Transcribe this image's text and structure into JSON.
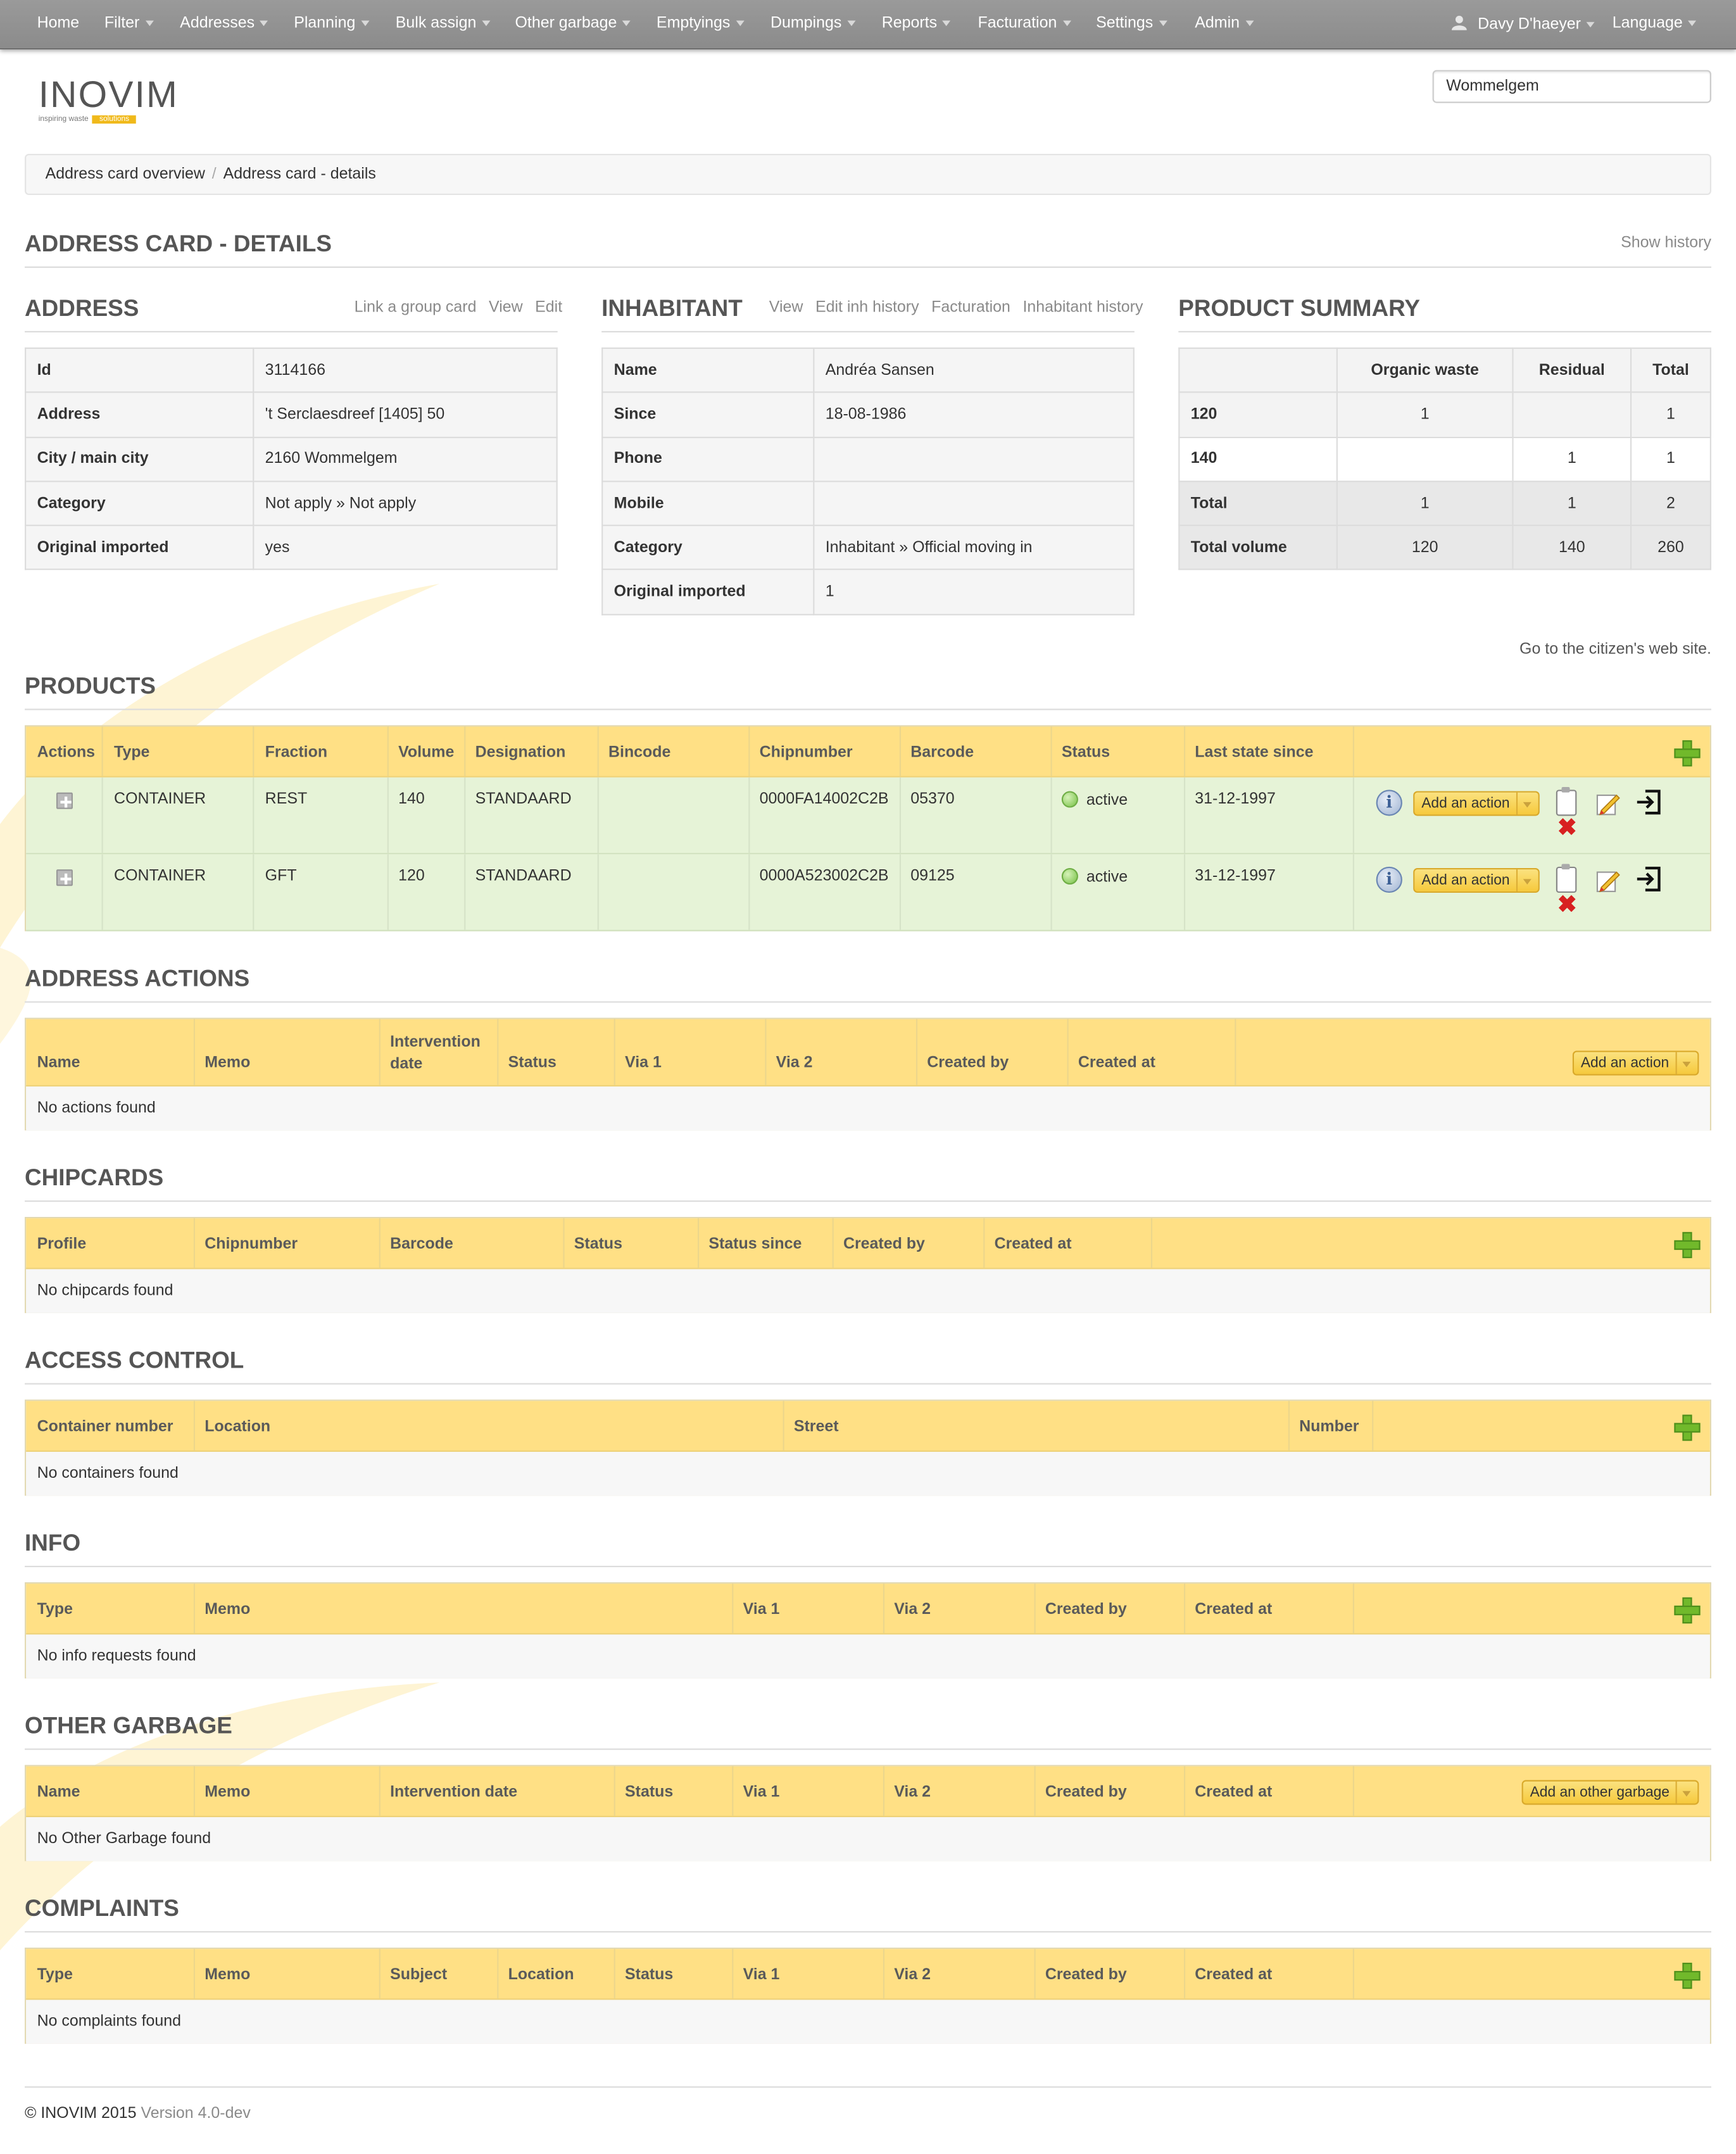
{
  "nav": {
    "items": [
      {
        "label": "Home",
        "caret": false
      },
      {
        "label": "Filter",
        "caret": true
      },
      {
        "label": "Addresses",
        "caret": true
      },
      {
        "label": "Planning",
        "caret": true
      },
      {
        "label": "Bulk assign",
        "caret": true
      },
      {
        "label": "Other garbage",
        "caret": true
      },
      {
        "label": "Emptyings",
        "caret": true
      },
      {
        "label": "Dumpings",
        "caret": true
      },
      {
        "label": "Reports",
        "caret": true
      },
      {
        "label": "Facturation",
        "caret": true
      },
      {
        "label": "Settings",
        "caret": true
      },
      {
        "label": "Admin",
        "caret": true
      }
    ],
    "user": "Davy D'haeyer",
    "language": "Language"
  },
  "logo": {
    "word": "INOVIM",
    "tagline": "inspiring waste",
    "tagline_highlight": "solutions"
  },
  "search": {
    "value": "Wommelgem"
  },
  "breadcrumb": {
    "parent": "Address card overview",
    "current": "Address card - details"
  },
  "page": {
    "title": "ADDRESS CARD - DETAILS",
    "show_history": "Show history"
  },
  "address": {
    "title": "ADDRESS",
    "links": [
      "Link a group card",
      "View",
      "Edit"
    ],
    "rows": [
      {
        "k": "Id",
        "v": "3114166"
      },
      {
        "k": "Address",
        "v": "'t Serclaesdreef [1405] 50"
      },
      {
        "k": "City / main city",
        "v": "2160 Wommelgem"
      },
      {
        "k": "Category",
        "v": "Not apply » Not apply"
      },
      {
        "k": "Original imported",
        "v": "yes"
      }
    ]
  },
  "inhabitant": {
    "title": "INHABITANT",
    "links": [
      "View",
      "Edit inh history",
      "Facturation",
      "Inhabitant history"
    ],
    "rows": [
      {
        "k": "Name",
        "v": "Andréa Sansen"
      },
      {
        "k": "Since",
        "v": "18-08-1986"
      },
      {
        "k": "Phone",
        "v": ""
      },
      {
        "k": "Mobile",
        "v": ""
      },
      {
        "k": "Category",
        "v": "Inhabitant » Official moving in"
      },
      {
        "k": "Original imported",
        "v": "1"
      }
    ]
  },
  "summary": {
    "title": "PRODUCT SUMMARY",
    "headers": [
      "",
      "Organic waste",
      "Residual",
      "Total"
    ],
    "rows": [
      [
        "120",
        "1",
        "",
        "1"
      ],
      [
        "140",
        "",
        "1",
        "1"
      ],
      [
        "Total",
        "1",
        "1",
        "2"
      ],
      [
        "Total volume",
        "120",
        "140",
        "260"
      ]
    ],
    "citizen_link": "Go to the citizen's web site."
  },
  "products": {
    "title": "PRODUCTS",
    "headers": [
      "Actions",
      "Type",
      "Fraction",
      "Volume",
      "Designation",
      "Bincode",
      "Chipnumber",
      "Barcode",
      "Status",
      "Last state since"
    ],
    "rows": [
      {
        "type": "CONTAINER",
        "fraction": "REST",
        "volume": "140",
        "designation": "STANDAARD",
        "bincode": "",
        "chipnumber": "0000FA14002C2B",
        "barcode": "05370",
        "status": "active",
        "since": "31-12-1997",
        "action": "Add an action"
      },
      {
        "type": "CONTAINER",
        "fraction": "GFT",
        "volume": "120",
        "designation": "STANDAARD",
        "bincode": "",
        "chipnumber": "0000A523002C2B",
        "barcode": "09125",
        "status": "active",
        "since": "31-12-1997",
        "action": "Add an action"
      }
    ]
  },
  "address_actions": {
    "title": "ADDRESS ACTIONS",
    "headers": [
      "Name",
      "Memo",
      "Intervention date",
      "Status",
      "Via 1",
      "Via 2",
      "Created by",
      "Created at"
    ],
    "button": "Add an action",
    "empty": "No actions found"
  },
  "chipcards": {
    "title": "CHIPCARDS",
    "headers": [
      "Profile",
      "Chipnumber",
      "Barcode",
      "Status",
      "Status since",
      "Created by",
      "Created at"
    ],
    "empty": "No chipcards found"
  },
  "access_control": {
    "title": "ACCESS CONTROL",
    "headers": [
      "Container number",
      "Location",
      "Street",
      "Number"
    ],
    "empty": "No containers found"
  },
  "info": {
    "title": "INFO",
    "headers": [
      "Type",
      "Memo",
      "Via 1",
      "Via 2",
      "Created by",
      "Created at"
    ],
    "empty": "No info requests found"
  },
  "other_garbage": {
    "title": "OTHER GARBAGE",
    "headers": [
      "Name",
      "Memo",
      "Intervention date",
      "Status",
      "Via 1",
      "Via 2",
      "Created by",
      "Created at"
    ],
    "button": "Add an other garbage",
    "empty": "No Other Garbage found"
  },
  "complaints": {
    "title": "COMPLAINTS",
    "headers": [
      "Type",
      "Memo",
      "Subject",
      "Location",
      "Status",
      "Via 1",
      "Via 2",
      "Created by",
      "Created at"
    ],
    "empty": "No complaints found"
  },
  "footer": {
    "copyright": "© INOVIM 2015",
    "version": "Version 4.0-dev"
  },
  "colors": {
    "header_yellow": "#ffe085",
    "product_row_green": "#e6f3d7",
    "navbar_gray": "#919191",
    "button_yellow": "#f6c93c"
  }
}
